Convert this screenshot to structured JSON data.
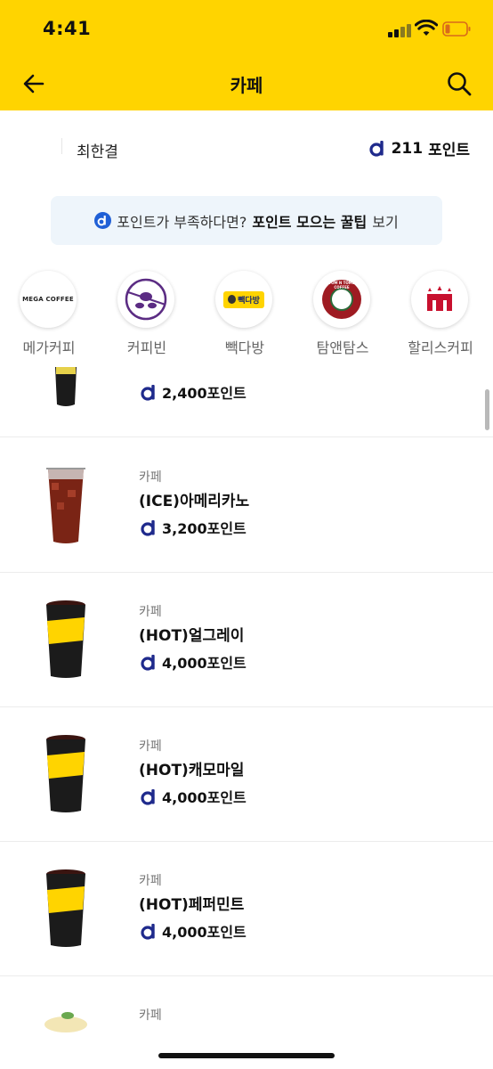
{
  "status": {
    "time": "4:41"
  },
  "nav": {
    "title": "카페"
  },
  "user": {
    "name": "최한결",
    "points": "211",
    "points_unit": "포인트"
  },
  "tip": {
    "prefix": "포인트가 부족하다면?",
    "highlight": "포인트 모으는 꿀팁",
    "suffix": "보기"
  },
  "brands": [
    {
      "label": "메가커피",
      "logo_text": "MEGA COFFEE"
    },
    {
      "label": "커피빈",
      "logo_text": ""
    },
    {
      "label": "빽다방",
      "logo_text": "빽다방"
    },
    {
      "label": "탐앤탐스",
      "logo_text": "TOM N TOMS COFFEE"
    },
    {
      "label": "할리스커피",
      "logo_text": ""
    }
  ],
  "products": [
    {
      "category": "",
      "name": "",
      "price": "2,400포인트"
    },
    {
      "category": "카페",
      "name": "(ICE)아메리카노",
      "price": "3,200포인트"
    },
    {
      "category": "카페",
      "name": "(HOT)얼그레이",
      "price": "4,000포인트"
    },
    {
      "category": "카페",
      "name": "(HOT)캐모마일",
      "price": "4,000포인트"
    },
    {
      "category": "카페",
      "name": "(HOT)페퍼민트",
      "price": "4,000포인트"
    },
    {
      "category": "카페",
      "name": "",
      "price": ""
    }
  ],
  "colors": {
    "header_yellow": "#FFD400",
    "point_blue": "#1F2A8C",
    "banner_bg": "#EEF5FB"
  }
}
